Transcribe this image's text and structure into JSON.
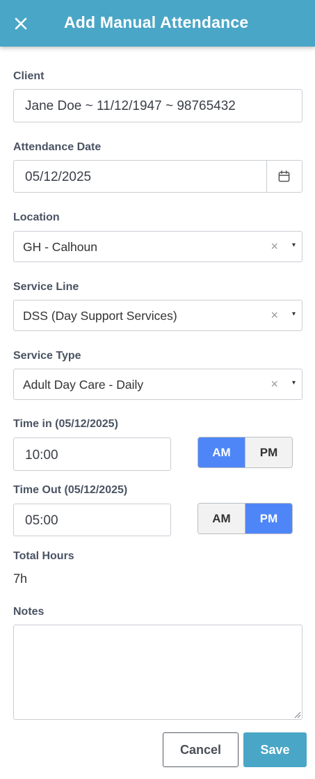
{
  "header": {
    "title": "Add Manual Attendance",
    "close_icon": "close-icon",
    "bg_color": "#4aa6c6"
  },
  "client": {
    "label": "Client",
    "value": "Jane Doe ~ 11/12/1947 ~ 98765432"
  },
  "attendance_date": {
    "label": "Attendance Date",
    "value": "05/12/2025",
    "icon": "calendar-icon"
  },
  "location": {
    "label": "Location",
    "value": "GH - Calhoun",
    "clear": "×",
    "caret": "▾"
  },
  "service_line": {
    "label": "Service Line",
    "value": "DSS (Day Support Services)",
    "clear": "×",
    "caret": "▾"
  },
  "service_type": {
    "label": "Service Type",
    "value": "Adult Day Care - Daily",
    "clear": "×",
    "caret": "▾"
  },
  "time_in": {
    "label": "Time in (05/12/2025)",
    "value": "10:00",
    "am": "AM",
    "pm": "PM",
    "selected": "AM"
  },
  "time_out": {
    "label": "Time Out (05/12/2025)",
    "value": "05:00",
    "am": "AM",
    "pm": "PM",
    "selected": "PM"
  },
  "total_hours": {
    "label": "Total Hours",
    "value": "7h"
  },
  "notes": {
    "label": "Notes",
    "value": ""
  },
  "actions": {
    "cancel": "Cancel",
    "save": "Save"
  },
  "colors": {
    "accent": "#4aa6c6",
    "toggle_on": "#4f86f7"
  }
}
